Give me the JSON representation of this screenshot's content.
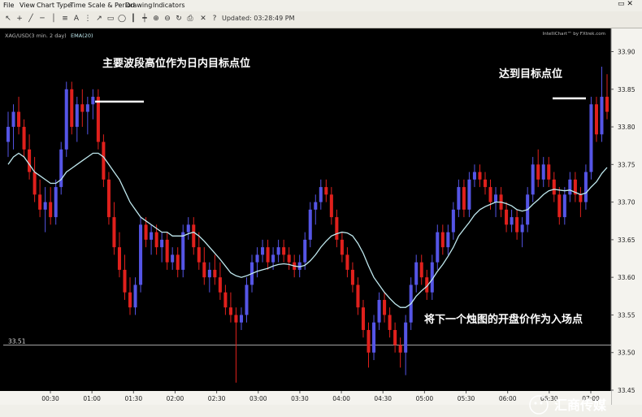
{
  "window": {
    "menu": [
      "File",
      "View",
      "Chart Type",
      "Time Scale & Period",
      "Drawing",
      "Indicators"
    ],
    "updated": "Updated: 03:28:49 PM"
  },
  "chart_header": {
    "symbol": "XAG/USD(3 min.  2 day)",
    "ema_label": "EMA(20)",
    "credit": "IntelliChart™ by FXtrek.com"
  },
  "annotations": {
    "high_point": "主要波段高位作为日内目标点位",
    "target_reached": "达到目标点位",
    "entry": "将下一个烛图的开盘价作为入场点"
  },
  "watermark": "汇商传媒",
  "colors": {
    "up_candle": "#5555e6",
    "down_candle": "#e0201c",
    "ema": "#bfe8ee",
    "level_line": "#d9d9d9"
  },
  "chart_data": {
    "type": "candlestick",
    "interval": "3 min",
    "ylim": [
      33.45,
      33.92
    ],
    "yticks": [
      33.45,
      33.5,
      33.55,
      33.6,
      33.65,
      33.7,
      33.75,
      33.8,
      33.85,
      33.9
    ],
    "ytick_labels": [
      "33.45",
      "33.50",
      "33.55",
      "33.60",
      "33.65",
      "33.70",
      "33.75",
      "33.80",
      "33.85",
      "33.90"
    ],
    "xtick_labels": [
      "00:30",
      "01:00",
      "01:30",
      "02:00",
      "02:30",
      "03:00",
      "03:30",
      "04:00",
      "04:30",
      "05:00",
      "05:30",
      "06:00",
      "06:30",
      "07:00"
    ],
    "level_label": "33.51",
    "level": 33.51,
    "ohlc": [
      [
        33.78,
        33.82,
        33.76,
        33.8
      ],
      [
        33.8,
        33.83,
        33.77,
        33.82
      ],
      [
        33.82,
        33.84,
        33.79,
        33.8
      ],
      [
        33.8,
        33.81,
        33.76,
        33.77
      ],
      [
        33.77,
        33.79,
        33.73,
        33.74
      ],
      [
        33.74,
        33.76,
        33.7,
        33.71
      ],
      [
        33.71,
        33.73,
        33.68,
        33.69
      ],
      [
        33.69,
        33.72,
        33.66,
        33.7
      ],
      [
        33.7,
        33.72,
        33.67,
        33.68
      ],
      [
        33.68,
        33.73,
        33.67,
        33.72
      ],
      [
        33.72,
        33.78,
        33.71,
        33.77
      ],
      [
        33.77,
        33.86,
        33.76,
        33.85
      ],
      [
        33.85,
        33.86,
        33.79,
        33.8
      ],
      [
        33.8,
        33.84,
        33.78,
        33.83
      ],
      [
        33.83,
        33.85,
        33.8,
        33.82
      ],
      [
        33.82,
        33.84,
        33.79,
        33.83
      ],
      [
        33.83,
        33.85,
        33.81,
        33.84
      ],
      [
        33.84,
        33.85,
        33.77,
        33.78
      ],
      [
        33.78,
        33.79,
        33.72,
        33.73
      ],
      [
        33.73,
        33.74,
        33.67,
        33.68
      ],
      [
        33.68,
        33.7,
        33.63,
        33.64
      ],
      [
        33.64,
        33.66,
        33.6,
        33.61
      ],
      [
        33.61,
        33.63,
        33.57,
        33.58
      ],
      [
        33.58,
        33.6,
        33.55,
        33.56
      ],
      [
        33.56,
        33.6,
        33.55,
        33.59
      ],
      [
        33.59,
        33.68,
        33.58,
        33.67
      ],
      [
        33.67,
        33.68,
        33.64,
        33.65
      ],
      [
        33.65,
        33.67,
        33.63,
        33.66
      ],
      [
        33.66,
        33.67,
        33.63,
        33.64
      ],
      [
        33.64,
        33.66,
        33.62,
        33.65
      ],
      [
        33.65,
        33.66,
        33.61,
        33.62
      ],
      [
        33.62,
        33.64,
        33.61,
        33.63
      ],
      [
        33.63,
        33.64,
        33.6,
        33.61
      ],
      [
        33.61,
        33.67,
        33.6,
        33.66
      ],
      [
        33.66,
        33.68,
        33.65,
        33.67
      ],
      [
        33.67,
        33.68,
        33.63,
        33.64
      ],
      [
        33.64,
        33.66,
        33.61,
        33.62
      ],
      [
        33.62,
        33.64,
        33.59,
        33.6
      ],
      [
        33.6,
        33.62,
        33.58,
        33.61
      ],
      [
        33.61,
        33.63,
        33.59,
        33.6
      ],
      [
        33.6,
        33.62,
        33.57,
        33.58
      ],
      [
        33.58,
        33.59,
        33.55,
        33.56
      ],
      [
        33.56,
        33.58,
        33.54,
        33.55
      ],
      [
        33.55,
        33.56,
        33.46,
        33.54
      ],
      [
        33.54,
        33.56,
        33.53,
        33.55
      ],
      [
        33.55,
        33.6,
        33.54,
        33.59
      ],
      [
        33.59,
        33.63,
        33.58,
        33.62
      ],
      [
        33.62,
        33.64,
        33.6,
        33.63
      ],
      [
        33.63,
        33.65,
        33.62,
        33.64
      ],
      [
        33.64,
        33.65,
        33.61,
        33.62
      ],
      [
        33.62,
        33.64,
        33.61,
        33.63
      ],
      [
        33.63,
        33.65,
        33.62,
        33.64
      ],
      [
        33.64,
        33.65,
        33.62,
        33.63
      ],
      [
        33.63,
        33.64,
        33.61,
        33.62
      ],
      [
        33.62,
        33.63,
        33.6,
        33.61
      ],
      [
        33.61,
        33.63,
        33.6,
        33.62
      ],
      [
        33.62,
        33.66,
        33.61,
        33.65
      ],
      [
        33.65,
        33.7,
        33.64,
        33.69
      ],
      [
        33.69,
        33.71,
        33.67,
        33.7
      ],
      [
        33.7,
        33.73,
        33.69,
        33.72
      ],
      [
        33.72,
        33.73,
        33.7,
        33.71
      ],
      [
        33.71,
        33.72,
        33.67,
        33.68
      ],
      [
        33.68,
        33.69,
        33.64,
        33.65
      ],
      [
        33.65,
        33.66,
        33.62,
        33.63
      ],
      [
        33.63,
        33.64,
        33.6,
        33.61
      ],
      [
        33.61,
        33.62,
        33.58,
        33.59
      ],
      [
        33.59,
        33.6,
        33.55,
        33.56
      ],
      [
        33.56,
        33.57,
        33.52,
        33.53
      ],
      [
        33.53,
        33.54,
        33.48,
        33.5
      ],
      [
        33.5,
        33.55,
        33.49,
        33.54
      ],
      [
        33.54,
        33.58,
        33.53,
        33.57
      ],
      [
        33.57,
        33.58,
        33.54,
        33.55
      ],
      [
        33.55,
        33.56,
        33.52,
        33.53
      ],
      [
        33.53,
        33.54,
        33.5,
        33.51
      ],
      [
        33.51,
        33.52,
        33.48,
        33.5
      ],
      [
        33.5,
        33.55,
        33.47,
        33.54
      ],
      [
        33.54,
        33.6,
        33.53,
        33.59
      ],
      [
        33.59,
        33.63,
        33.58,
        33.62
      ],
      [
        33.62,
        33.63,
        33.59,
        33.6
      ],
      [
        33.6,
        33.61,
        33.57,
        33.58
      ],
      [
        33.58,
        33.63,
        33.57,
        33.62
      ],
      [
        33.62,
        33.67,
        33.61,
        33.66
      ],
      [
        33.66,
        33.67,
        33.63,
        33.64
      ],
      [
        33.64,
        33.67,
        33.63,
        33.66
      ],
      [
        33.66,
        33.7,
        33.65,
        33.69
      ],
      [
        33.69,
        33.73,
        33.68,
        33.72
      ],
      [
        33.72,
        33.73,
        33.68,
        33.69
      ],
      [
        33.69,
        33.74,
        33.68,
        33.73
      ],
      [
        33.73,
        33.75,
        33.72,
        33.74
      ],
      [
        33.74,
        33.75,
        33.72,
        33.73
      ],
      [
        33.73,
        33.74,
        33.71,
        33.72
      ],
      [
        33.72,
        33.73,
        33.69,
        33.7
      ],
      [
        33.7,
        33.72,
        33.68,
        33.71
      ],
      [
        33.71,
        33.72,
        33.68,
        33.69
      ],
      [
        33.69,
        33.7,
        33.66,
        33.67
      ],
      [
        33.67,
        33.69,
        33.66,
        33.68
      ],
      [
        33.68,
        33.69,
        33.65,
        33.66
      ],
      [
        33.66,
        33.68,
        33.64,
        33.67
      ],
      [
        33.67,
        33.72,
        33.66,
        33.71
      ],
      [
        33.71,
        33.76,
        33.7,
        33.75
      ],
      [
        33.75,
        33.77,
        33.72,
        33.73
      ],
      [
        33.73,
        33.76,
        33.72,
        33.75
      ],
      [
        33.75,
        33.76,
        33.72,
        33.73
      ],
      [
        33.73,
        33.74,
        33.7,
        33.71
      ],
      [
        33.71,
        33.72,
        33.67,
        33.68
      ],
      [
        33.68,
        33.72,
        33.67,
        33.71
      ],
      [
        33.71,
        33.74,
        33.7,
        33.73
      ],
      [
        33.73,
        33.74,
        33.7,
        33.71
      ],
      [
        33.71,
        33.72,
        33.68,
        33.7
      ],
      [
        33.7,
        33.75,
        33.69,
        33.74
      ],
      [
        33.74,
        33.84,
        33.73,
        33.83
      ],
      [
        33.83,
        33.84,
        33.78,
        33.79
      ],
      [
        33.79,
        33.88,
        33.78,
        33.84
      ],
      [
        33.84,
        33.87,
        33.81,
        33.82
      ]
    ],
    "ema": [
      33.75,
      33.76,
      33.765,
      33.76,
      33.75,
      33.74,
      33.735,
      33.73,
      33.725,
      33.725,
      33.73,
      33.74,
      33.745,
      33.75,
      33.755,
      33.76,
      33.765,
      33.765,
      33.76,
      33.75,
      33.74,
      33.73,
      33.715,
      33.7,
      33.69,
      33.68,
      33.675,
      33.67,
      33.665,
      33.66,
      33.66,
      33.655,
      33.655,
      33.655,
      33.658,
      33.66,
      33.655,
      33.648,
      33.64,
      33.632,
      33.624,
      33.615,
      33.606,
      33.602,
      33.6,
      33.602,
      33.605,
      33.608,
      33.61,
      33.612,
      33.615,
      33.617,
      33.618,
      33.617,
      33.615,
      33.614,
      33.616,
      33.622,
      33.63,
      33.64,
      33.648,
      33.655,
      33.658,
      33.66,
      33.659,
      33.655,
      33.645,
      33.632,
      33.615,
      33.6,
      33.59,
      33.58,
      33.572,
      33.565,
      33.56,
      33.56,
      33.565,
      33.575,
      33.582,
      33.588,
      33.597,
      33.608,
      33.617,
      33.628,
      33.64,
      33.655,
      33.664,
      33.673,
      33.683,
      33.69,
      33.694,
      33.697,
      33.7,
      33.7,
      33.698,
      33.695,
      33.69,
      33.688,
      33.69,
      33.697,
      33.703,
      33.71,
      33.715,
      33.717,
      33.716,
      33.715,
      33.716,
      33.713,
      33.71,
      33.712,
      33.72,
      33.727,
      33.738,
      33.746
    ]
  }
}
